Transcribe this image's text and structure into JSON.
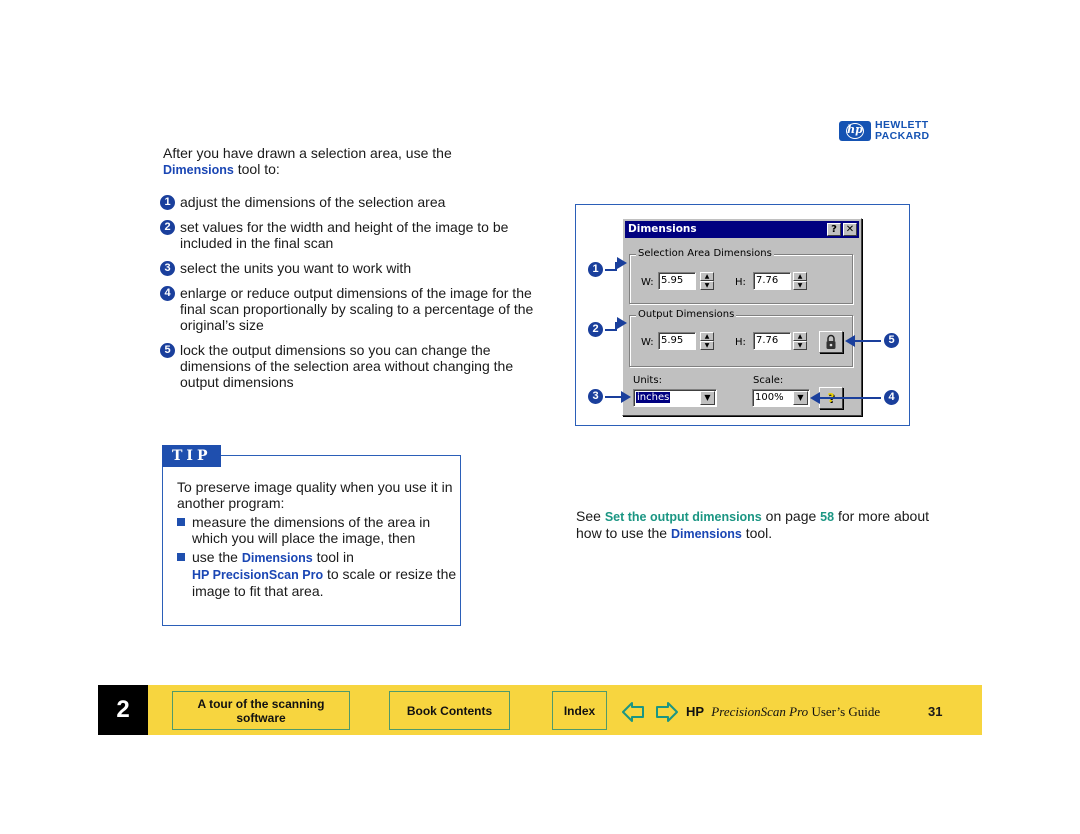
{
  "logo": {
    "mark": "hp",
    "line1": "HEWLETT",
    "line2": "PACKARD"
  },
  "intro": {
    "before": "After you have drawn a selection area, use the",
    "tool": "Dimensions",
    "after": " tool to:"
  },
  "steps": [
    {
      "num": "1",
      "text": "adjust the dimensions of the selection area"
    },
    {
      "num": "2",
      "text": "set values for the width and height of the image to be included in the final scan"
    },
    {
      "num": "3",
      "text": "select the units you want to work with"
    },
    {
      "num": "4",
      "text": "enlarge or reduce output dimensions of the image for the final scan proportionally by scaling to a percentage of the original’s size"
    },
    {
      "num": "5",
      "text": "lock the output dimensions so you can change the dimensions of the selection area without changing the output dimensions"
    }
  ],
  "tip": {
    "label": "TIP",
    "intro": "To preserve image quality when you use it in another program:",
    "item1": "measure the dimensions of the area in which you will place the image, then",
    "item2_before": "use the ",
    "item2_tool": "Dimensions",
    "item2_mid": " tool in",
    "item2_product": "HP PrecisionScan Pro",
    "item2_after": " to scale or resize the image to fit that area."
  },
  "dialog": {
    "title": "Dimensions",
    "help_btn": "?",
    "close_btn": "✕",
    "selection_group": "Selection Area Dimensions",
    "output_group": "Output Dimensions",
    "w_label": "W:",
    "h_label": "H:",
    "sel_w": "5.95",
    "sel_h": "7.76",
    "out_w": "5.95",
    "out_h": "7.76",
    "units_label": "Units:",
    "units_value": "inches",
    "scale_label": "Scale:",
    "scale_value": "100%",
    "lock_icon": "lock-icon",
    "help_icon": "question-icon"
  },
  "callouts": {
    "c1": "1",
    "c2": "2",
    "c3": "3",
    "c4": "4",
    "c5": "5"
  },
  "see_more": {
    "see": "See ",
    "link": "Set the output dimensions",
    "on_page": " on page ",
    "page": "58",
    "for_more": " for more about how to use the ",
    "tool": "Dimensions",
    "tool_end": " tool."
  },
  "footer": {
    "chapter": "2",
    "section_btn": "A tour of the scanning software",
    "contents_btn": "Book Contents",
    "index_btn": "Index",
    "prev_icon": "back-arrow-icon",
    "next_icon": "forward-arrow-icon",
    "guide_hp": "HP",
    "guide_product": "PrecisionScan Pro",
    "guide_suffix": " User’s Guide",
    "page_number": "31"
  },
  "colors": {
    "accent_blue": "#1a46b4",
    "link_teal": "#1b9683",
    "footer_yellow": "#f7d53f",
    "titlebar_navy": "#000080"
  }
}
